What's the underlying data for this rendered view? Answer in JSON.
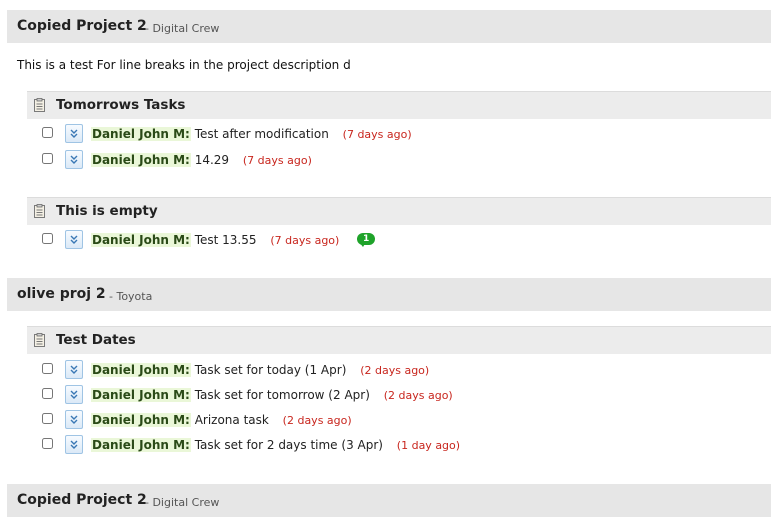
{
  "projects": [
    {
      "title": "Copied Project 2",
      "client": "- Digital Crew",
      "description": "This is a test For line breaks in the project description d",
      "lists": [
        {
          "title": "Tomorrows Tasks",
          "tasks": [
            {
              "owner": "Daniel John M:",
              "text": "Test after modification",
              "age": "(7 days ago)"
            },
            {
              "owner": "Daniel John M:",
              "text": "14.29",
              "age": "(7 days ago)"
            }
          ]
        },
        {
          "title": "This is empty",
          "tasks": [
            {
              "owner": "Daniel John M:",
              "text": "Test 13.55",
              "age": "(7 days ago)",
              "comments": "1"
            }
          ]
        }
      ]
    },
    {
      "title": "olive proj 2",
      "client": "- Toyota",
      "lists": [
        {
          "title": "Test Dates",
          "tasks": [
            {
              "owner": "Daniel John M:",
              "text": "Task set for today (1 Apr)",
              "age": "(2 days ago)"
            },
            {
              "owner": "Daniel John M:",
              "text": "Task set for tomorrow (2 Apr)",
              "age": "(2 days ago)"
            },
            {
              "owner": "Daniel John M:",
              "text": "Arizona task",
              "age": "(2 days ago)"
            },
            {
              "owner": "Daniel John M:",
              "text": "Task set for 2 days time (3 Apr)",
              "age": "(1 day ago)"
            }
          ]
        }
      ]
    },
    {
      "title": "Copied Project 2",
      "client": "- Digital Crew"
    }
  ],
  "icons": {
    "list": "clipboard-icon",
    "toggle": "double-chevron-down-icon",
    "comment": "comment-bubble-icon"
  },
  "colors": {
    "owner_highlight": "#eaf7d8",
    "age_text": "#c8261e",
    "comment_badge": "#1fa32a"
  }
}
